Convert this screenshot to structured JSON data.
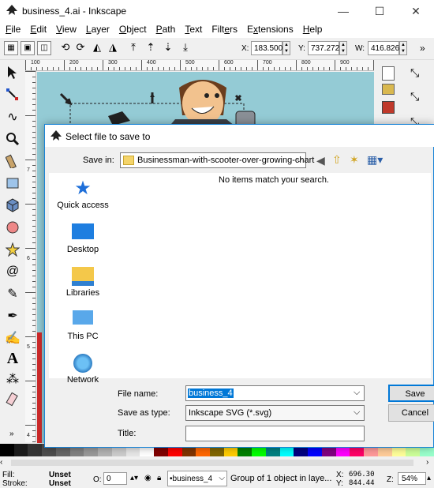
{
  "window": {
    "title": "business_4.ai - Inkscape",
    "controls": {
      "minimize": "—",
      "maximize": "☐",
      "close": "✕"
    }
  },
  "menu": [
    {
      "hot": "F",
      "rest": "ile"
    },
    {
      "hot": "E",
      "rest": "dit"
    },
    {
      "hot": "V",
      "rest": "iew"
    },
    {
      "hot": "L",
      "rest": "ayer"
    },
    {
      "hot": "O",
      "rest": "bject"
    },
    {
      "hot": "P",
      "rest": "ath"
    },
    {
      "hot": "T",
      "rest": "ext"
    },
    {
      "pre": "Filt",
      "hot": "e",
      "rest": "rs"
    },
    {
      "pre": "E",
      "hot": "x",
      "rest": "tensions"
    },
    {
      "hot": "H",
      "rest": "elp"
    }
  ],
  "toolbar": {
    "x_label": "X:",
    "x_value": "183.500",
    "y_label": "Y:",
    "y_value": "737.272",
    "w_label": "W:",
    "w_value": "416.826",
    "overflow": "»"
  },
  "ruler": {
    "h": [
      "100",
      "200",
      "300",
      "400",
      "500",
      "600",
      "700",
      "800",
      "900"
    ],
    "v": [
      "7",
      "6",
      "5",
      "4"
    ]
  },
  "tools_overflow": "»",
  "dialog": {
    "title": "Select file to save to",
    "save_in_label": "Save in:",
    "save_in_value": "Businessman-with-scooter-over-growing-chart",
    "empty_message": "No items match your search.",
    "places": [
      "Quick access",
      "Desktop",
      "Libraries",
      "This PC",
      "Network"
    ],
    "file_name_label": "File name:",
    "file_name_value": "business_4",
    "save_type_label": "Save as type:",
    "save_type_value": "Inkscape SVG (*.svg)",
    "title_label": "Title:",
    "title_value": "",
    "save_button": "Save",
    "cancel_button": "Cancel"
  },
  "status": {
    "fill_label": "Fill:",
    "fill_value": "Unset",
    "stroke_label": "Stroke:",
    "stroke_value": "Unset",
    "opacity_label": "O:",
    "opacity_value": "0",
    "layer_value": "•business_4",
    "message": "Group of 1 object in laye...",
    "x_label": "X:",
    "x_value": "696.30",
    "y_label": "Y:",
    "y_value": "844.44",
    "zoom_label": "Z:",
    "zoom_value": "54%"
  },
  "colors": {
    "canvas": "#94cbd5",
    "accent": "#1883d7",
    "palette": [
      "#000000",
      "#1a1a1a",
      "#333333",
      "#4d4d4d",
      "#666666",
      "#808080",
      "#999999",
      "#b3b3b3",
      "#cccccc",
      "#e6e6e6",
      "#ffffff",
      "#800000",
      "#ff0000",
      "#803300",
      "#ff6600",
      "#806600",
      "#ffcc00",
      "#008000",
      "#00ff00",
      "#008080",
      "#00ffff",
      "#000080",
      "#0000ff",
      "#800080",
      "#ff00ff",
      "#ff0066",
      "#ff9999",
      "#ffcc99",
      "#ffff99",
      "#ccff99",
      "#99ffcc"
    ]
  }
}
